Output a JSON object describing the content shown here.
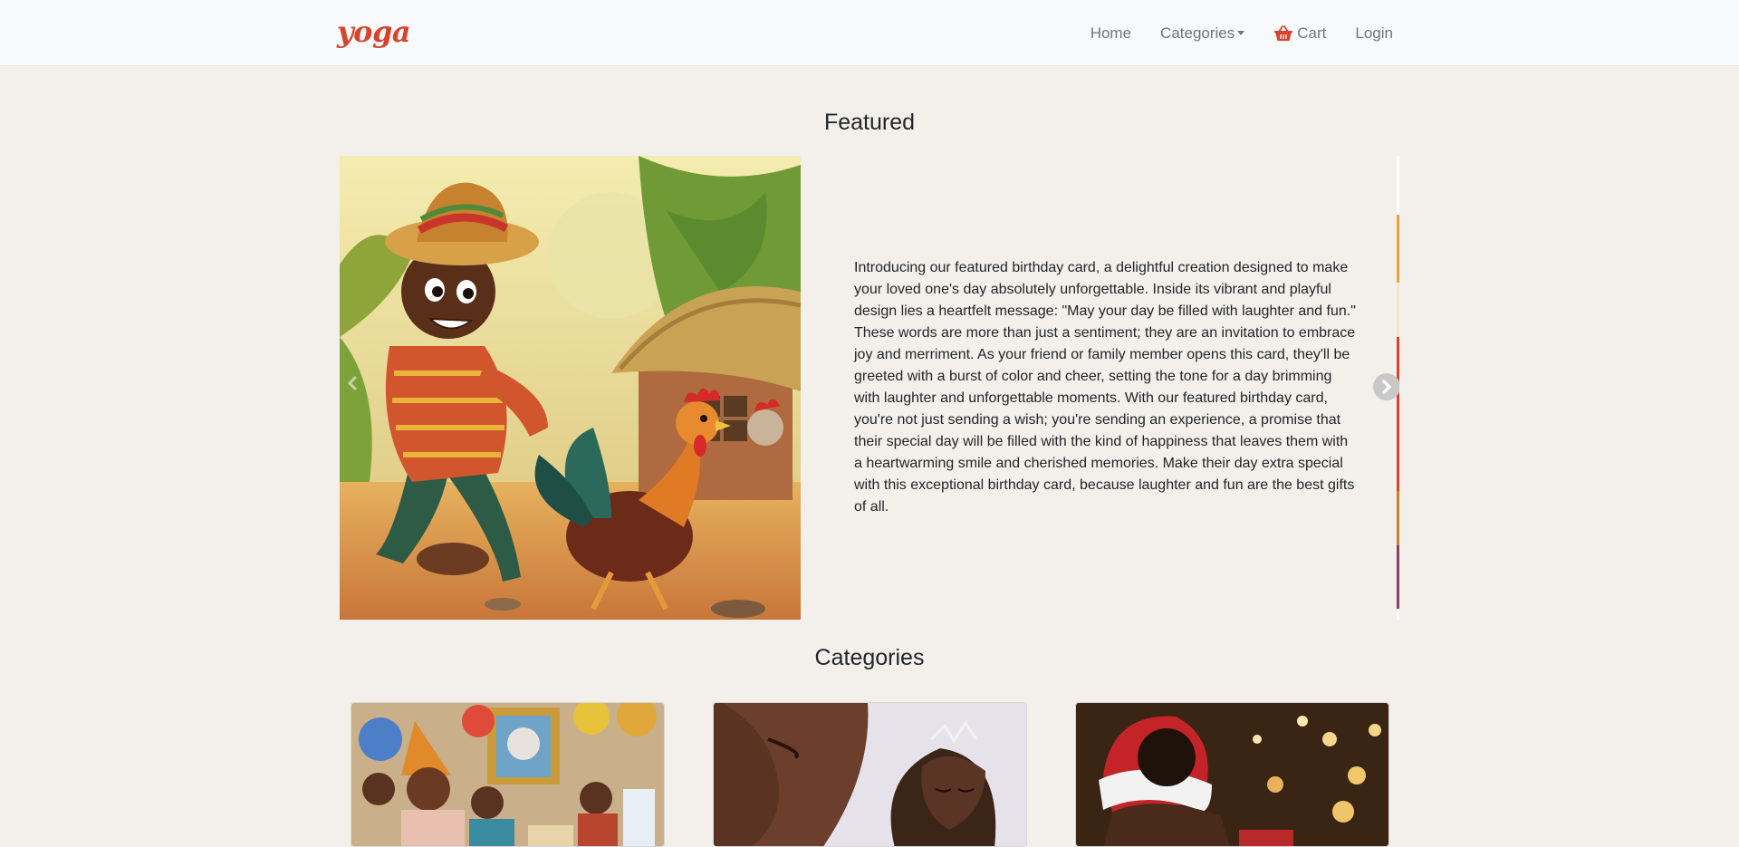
{
  "navbar": {
    "brand": "yoga",
    "links": {
      "home": "Home",
      "categories": "Categories",
      "cart": "Cart",
      "login": "Login"
    },
    "icons": {
      "cart": "basket-icon",
      "dropdown": "caret-down-icon"
    }
  },
  "featured": {
    "title": "Featured",
    "description": "Introducing our featured birthday card, a delightful creation designed to make your loved one's day absolutely unforgettable. Inside its vibrant and playful design lies a heartfelt message: \"May your day be filled with laughter and fun.\" These words are more than just a sentiment; they are an invitation to embrace joy and merriment. As your friend or family member opens this card, they'll be greeted with a burst of color and cheer, setting the tone for a day brimming with laughter and unforgettable moments. With our featured birthday card, you're not just sending a wish; you're sending an experience, a promise that their special day will be filled with the kind of happiness that leaves them with a heartwarming smile and cherished memories. Make their day extra special with this exceptional birthday card, because laughter and fun are the best gifts of all.",
    "icons": {
      "prev": "chevron-left-icon",
      "next": "chevron-right-icon"
    }
  },
  "categories": {
    "title": "Categories"
  },
  "colors": {
    "brand": "#d9432c",
    "background": "#f3f0eb",
    "navbar": "#f8f9fa",
    "nav_text": "#6c757d"
  }
}
